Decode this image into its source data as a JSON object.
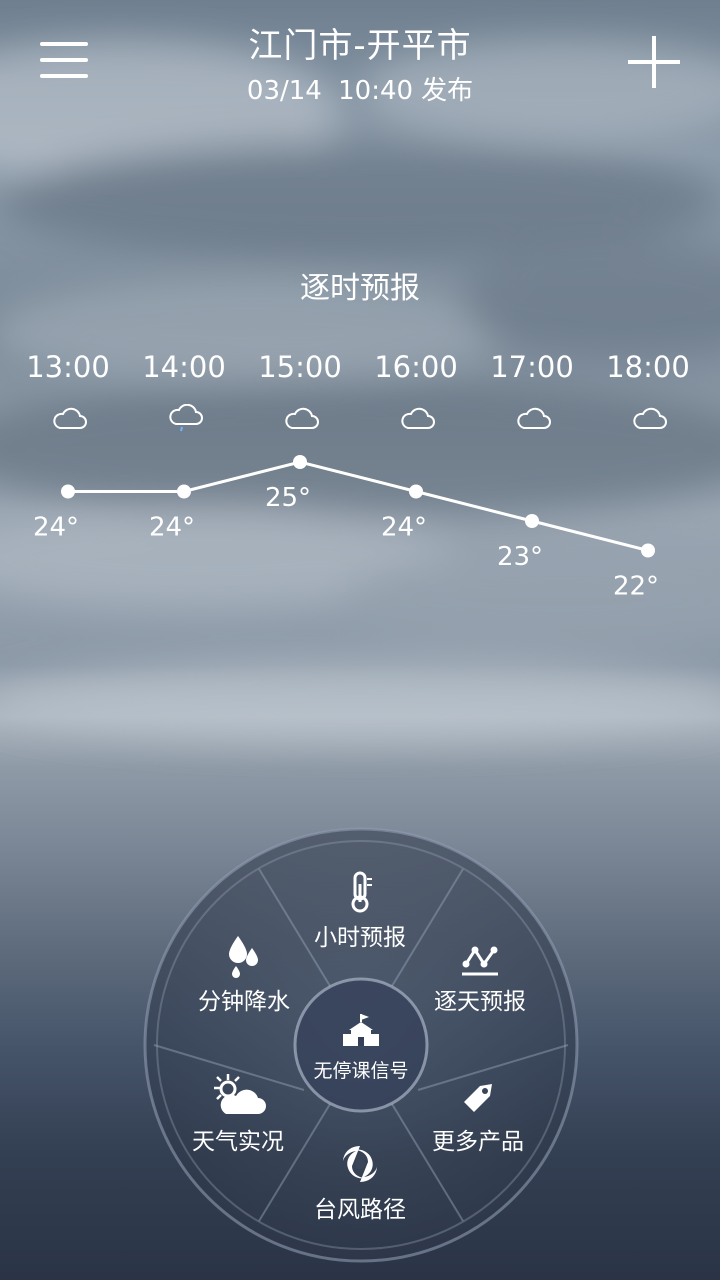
{
  "header": {
    "city": "江门市-开平市",
    "publish_date": "03/14",
    "publish_time": "10:40",
    "publish_suffix": "发布"
  },
  "hourly": {
    "title": "逐时预报",
    "hours": [
      {
        "time": "13:00",
        "icon": "cloud-icon",
        "temp": "24°",
        "value": 24
      },
      {
        "time": "14:00",
        "icon": "cloud-drizzle-icon",
        "temp": "24°",
        "value": 24
      },
      {
        "time": "15:00",
        "icon": "cloud-icon",
        "temp": "25°",
        "value": 25
      },
      {
        "time": "16:00",
        "icon": "cloud-icon",
        "temp": "24°",
        "value": 24
      },
      {
        "time": "17:00",
        "icon": "cloud-icon",
        "temp": "23°",
        "value": 23
      },
      {
        "time": "18:00",
        "icon": "cloud-icon",
        "temp": "22°",
        "value": 22
      }
    ]
  },
  "menu": {
    "top": "小时预报",
    "upper_right": "逐天预报",
    "lower_right": "更多产品",
    "bottom": "台风路径",
    "lower_left": "天气实况",
    "upper_left": "分钟降水",
    "center": "无停课信号"
  },
  "colors": {
    "text": "#ffffff",
    "wheel_bg": "#3a4558"
  }
}
